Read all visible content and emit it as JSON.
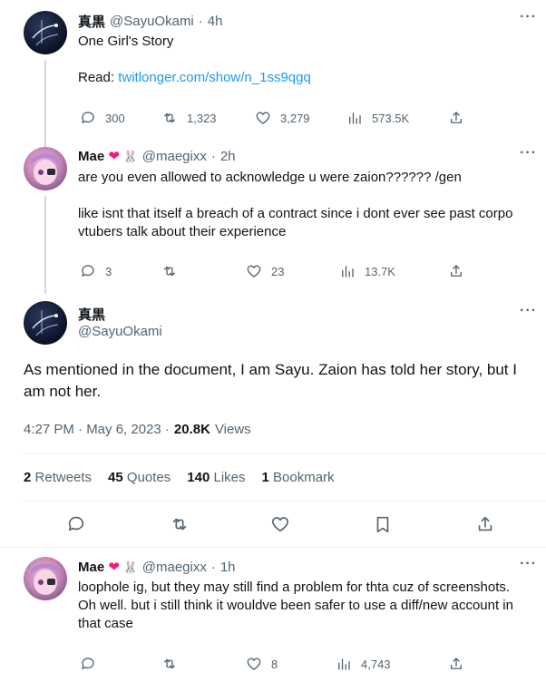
{
  "tweet1": {
    "name": "真黒",
    "handle": "@SayuOkami",
    "time": "4h",
    "line1": "One Girl's Story",
    "read_label": "Read:",
    "link": "twitlonger.com/show/n_1ss9qgq",
    "replies": "300",
    "retweets": "1,323",
    "likes": "3,279",
    "views": "573.5K"
  },
  "tweet2": {
    "name": "Mae",
    "handle": "@maegixx",
    "time": "2h",
    "line1": "are you even allowed to acknowledge u were zaion?????? /gen",
    "line2": "like isnt that itself a breach of a contract since i dont ever see past corpo",
    "line3": "vtubers talk about their experience",
    "replies": "3",
    "likes": "23",
    "views": "13.7K"
  },
  "main": {
    "name": "真黒",
    "handle": "@SayuOkami",
    "line1": "As mentioned in the document, I am Sayu. Zaion has told her story, but I",
    "line2": "am not her.",
    "time": "4:27 PM · May 6, 2023 ·",
    "views_count": "20.8K",
    "views_label": "Views",
    "retweets_count": "2",
    "retweets_label": "Retweets",
    "quotes_count": "45",
    "quotes_label": "Quotes",
    "likes_count": "140",
    "likes_label": "Likes",
    "bookmarks_count": "1",
    "bookmarks_label": "Bookmark"
  },
  "tweet3": {
    "name": "Mae",
    "handle": "@maegixx",
    "time": "1h",
    "line1": "loophole ig, but they may still find a problem for thta cuz of screenshots.",
    "line2": "Oh well. but i still think it wouldve been safer to use a diff/new account in",
    "line3": "that case",
    "likes": "8",
    "views": "4,743"
  },
  "icons": {
    "reply": "reply-icon",
    "retweet": "retweet-icon",
    "like": "heart-icon",
    "views": "views-icon",
    "share": "share-icon",
    "bookmark": "bookmark-icon",
    "more": "more-icon"
  },
  "colors": {
    "link": "#1d9bf0",
    "text": "#0f1419",
    "secondary": "#536471",
    "heart_emoji": "#f91880"
  }
}
